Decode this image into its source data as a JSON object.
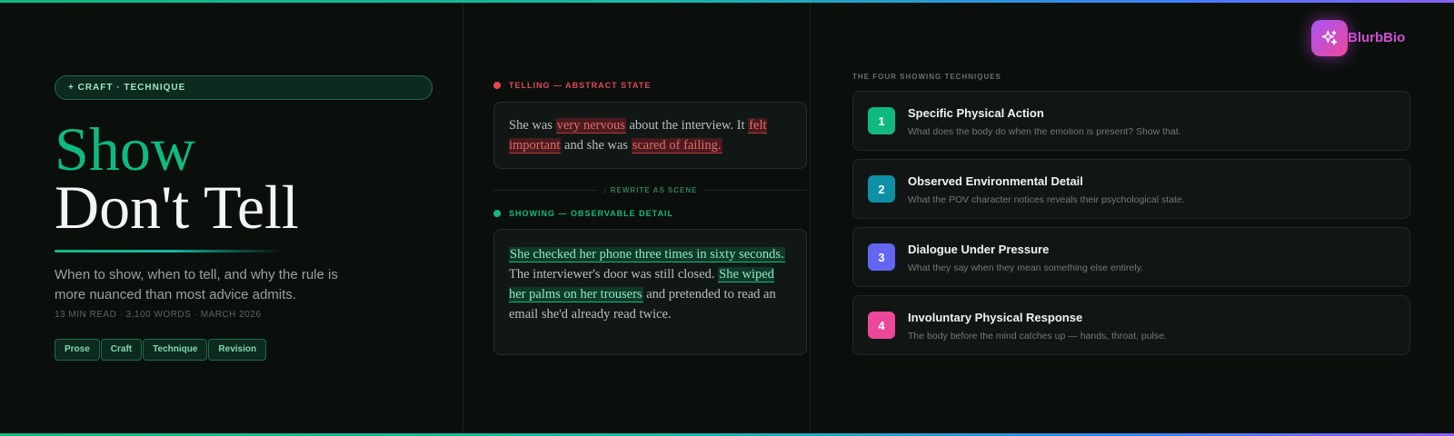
{
  "colors": {
    "accent_green": "#10b981",
    "telling_red": "#e24a4a",
    "brand_gradient_start": "#a855f7",
    "brand_gradient_end": "#ec4899"
  },
  "article": {
    "category": "+ CRAFT · TECHNIQUE",
    "title_line1": "Show",
    "title_line2": "Don't Tell",
    "subtitle": "When to show, when to tell, and why the rule is more nuanced than most advice admits.",
    "meta": "13 MIN READ · 3,100 WORDS · MARCH 2026",
    "tags": [
      "Prose",
      "Craft",
      "Technique",
      "Revision"
    ]
  },
  "comparison": {
    "telling_label": "TELLING — ABSTRACT STATE",
    "telling_parts": [
      {
        "text": "She was ",
        "hl": false
      },
      {
        "text": "very nervous",
        "hl": true
      },
      {
        "text": " about the interview. It ",
        "hl": false
      },
      {
        "text": "felt important",
        "hl": true
      },
      {
        "text": " and she was ",
        "hl": false
      },
      {
        "text": "scared of failing.",
        "hl": true
      }
    ],
    "rewrite_label": "↓ REWRITE AS SCENE",
    "showing_label": "SHOWING — OBSERVABLE DETAIL",
    "showing_parts": [
      {
        "text": "She checked her phone three times in sixty seconds.",
        "hl": true
      },
      {
        "text": " The interviewer's door was still closed. ",
        "hl": false
      },
      {
        "text": "She wiped her palms on her trousers",
        "hl": true
      },
      {
        "text": " and pretended to read an email she'd already read twice.",
        "hl": false
      }
    ]
  },
  "techniques": {
    "brand": "BlurbBio",
    "brand_icon": "sparkles-icon",
    "section_title": "THE FOUR SHOWING TECHNIQUES",
    "items": [
      {
        "num": "1",
        "title": "Specific Physical Action",
        "desc": "What does the body do when the emotion is present? Show that.",
        "color": "#10b981"
      },
      {
        "num": "2",
        "title": "Observed Environmental Detail",
        "desc": "What the POV character notices reveals their psychological state.",
        "color": "#0e8fa6"
      },
      {
        "num": "3",
        "title": "Dialogue Under Pressure",
        "desc": "What they say when they mean something else entirely.",
        "color": "#6366f1"
      },
      {
        "num": "4",
        "title": "Involuntary Physical Response",
        "desc": "The body before the mind catches up — hands, throat, pulse.",
        "color": "#ec4899"
      }
    ]
  }
}
